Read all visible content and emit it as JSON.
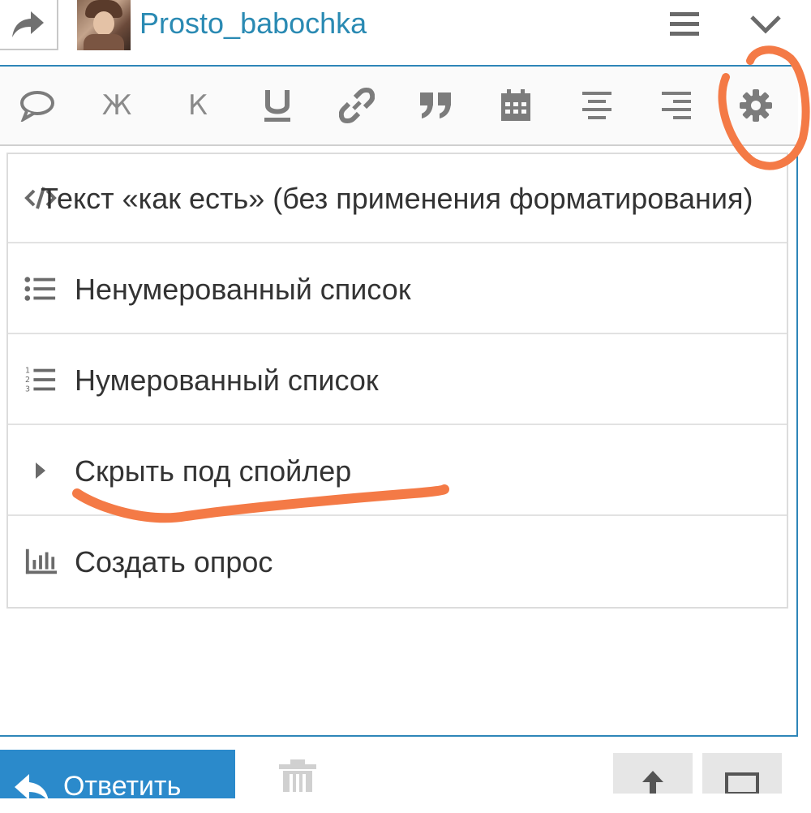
{
  "header": {
    "username": "Prosto_babochka",
    "share_icon": "share-arrow-icon",
    "menu_icon": "hamburger-icon",
    "collapse_icon": "chevron-down-icon"
  },
  "toolbar": {
    "items": [
      {
        "name": "quote-bubble-icon"
      },
      {
        "name": "bold",
        "label": "Ж"
      },
      {
        "name": "italic",
        "label": "К"
      },
      {
        "name": "underline-icon"
      },
      {
        "name": "link-icon"
      },
      {
        "name": "blockquote-icon"
      },
      {
        "name": "calendar-icon"
      },
      {
        "name": "align-center-icon"
      },
      {
        "name": "align-right-icon"
      },
      {
        "name": "gear-icon"
      }
    ]
  },
  "dropdown": {
    "items": [
      {
        "label": "Текст «как есть» (без применения форматирования)",
        "icon": "code-icon"
      },
      {
        "label": "Ненумерованный список",
        "icon": "bullet-list-icon"
      },
      {
        "label": "Нумерованный список",
        "icon": "numbered-list-icon"
      },
      {
        "label": "Скрыть под спойлер",
        "icon": "caret-right-icon"
      },
      {
        "label": "Создать опрос",
        "icon": "poll-chart-icon"
      }
    ]
  },
  "footer": {
    "reply_label": "Ответить",
    "trash_icon": "trash-icon"
  },
  "colors": {
    "accent": "#2b8acb",
    "link": "#2a8ab3",
    "annotation": "#f47a46"
  }
}
